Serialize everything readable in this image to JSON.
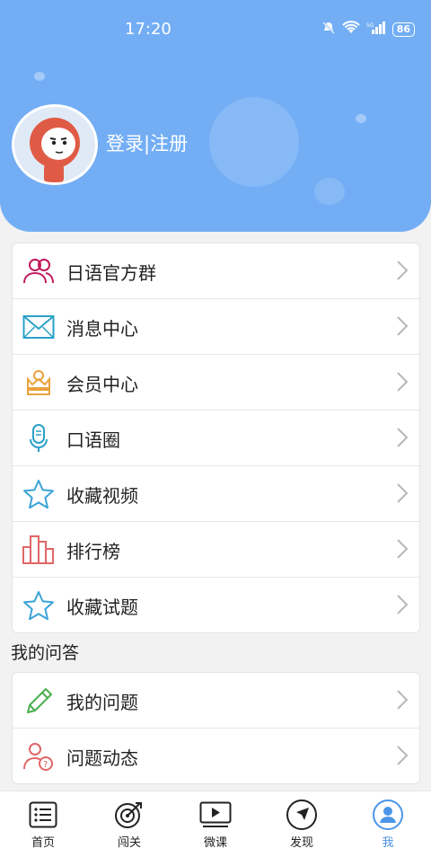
{
  "status_bar": {
    "time": "17:20",
    "battery": "86"
  },
  "profile": {
    "login_label": "登录|注册"
  },
  "menu": [
    {
      "label": "日语官方群",
      "icon": "group-users-icon"
    },
    {
      "label": "消息中心",
      "icon": "envelope-icon"
    },
    {
      "label": "会员中心",
      "icon": "crown-icon"
    },
    {
      "label": "口语圈",
      "icon": "microphone-icon"
    },
    {
      "label": "收藏视频",
      "icon": "star-icon"
    },
    {
      "label": "排行榜",
      "icon": "bar-chart-icon"
    },
    {
      "label": "收藏试题",
      "icon": "star-icon"
    }
  ],
  "qa_section": {
    "title": "我的问答",
    "items": [
      {
        "label": "我的问题",
        "icon": "pencil-icon"
      },
      {
        "label": "问题动态",
        "icon": "user-question-icon"
      }
    ]
  },
  "tabs": [
    {
      "label": "首页",
      "icon": "list-icon"
    },
    {
      "label": "闯关",
      "icon": "target-icon"
    },
    {
      "label": "微课",
      "icon": "play-icon"
    },
    {
      "label": "发现",
      "icon": "compass-icon"
    },
    {
      "label": "我",
      "icon": "user-icon",
      "active": true
    }
  ],
  "colors": {
    "header": "#73aef5",
    "active_tab": "#4b95e8"
  }
}
